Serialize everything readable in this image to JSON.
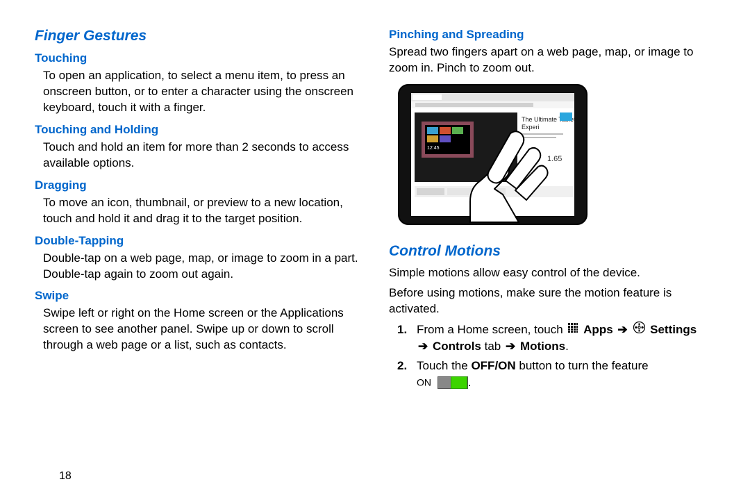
{
  "page_number": "18",
  "left": {
    "section_title": "Finger Gestures",
    "touching": {
      "heading": "Touching",
      "body": "To open an application, to select a menu item, to press an onscreen button, or to enter a character using the onscreen keyboard, touch it with a finger."
    },
    "touching_holding": {
      "heading": "Touching and Holding",
      "body": "Touch and hold an item for more than 2 seconds to access available options."
    },
    "dragging": {
      "heading": "Dragging",
      "body": "To move an icon, thumbnail, or preview to a new location, touch and hold it and drag it to the target position."
    },
    "double_tapping": {
      "heading": "Double-Tapping",
      "body": "Double-tap on a web page, map, or image to zoom in a part. Double-tap again to zoom out again."
    },
    "swipe": {
      "heading": "Swipe",
      "body": "Swipe left or right on the Home screen or the Applications screen to see another panel. Swipe up or down to scroll through a web page or a list, such as contacts."
    }
  },
  "right": {
    "pinching": {
      "heading": "Pinching and Spreading",
      "body": "Spread two fingers apart on a web page, map, or image to zoom in. Pinch to zoom out."
    },
    "control_motions": {
      "section_title": "Control Motions",
      "intro1": "Simple motions allow easy control of the device.",
      "intro2": "Before using motions, make sure the motion feature is activated.",
      "step1_prefix": "From a Home screen, touch ",
      "apps_label": "Apps",
      "arrow": "➔",
      "settings_label": "Settings",
      "controls_label": "Controls",
      "tab_word": " tab ",
      "motions_label": "Motions",
      "step2_prefix": "Touch the ",
      "offon_label": "OFF/ON",
      "step2_suffix": " button to turn the feature ",
      "on_label": "ON"
    }
  }
}
